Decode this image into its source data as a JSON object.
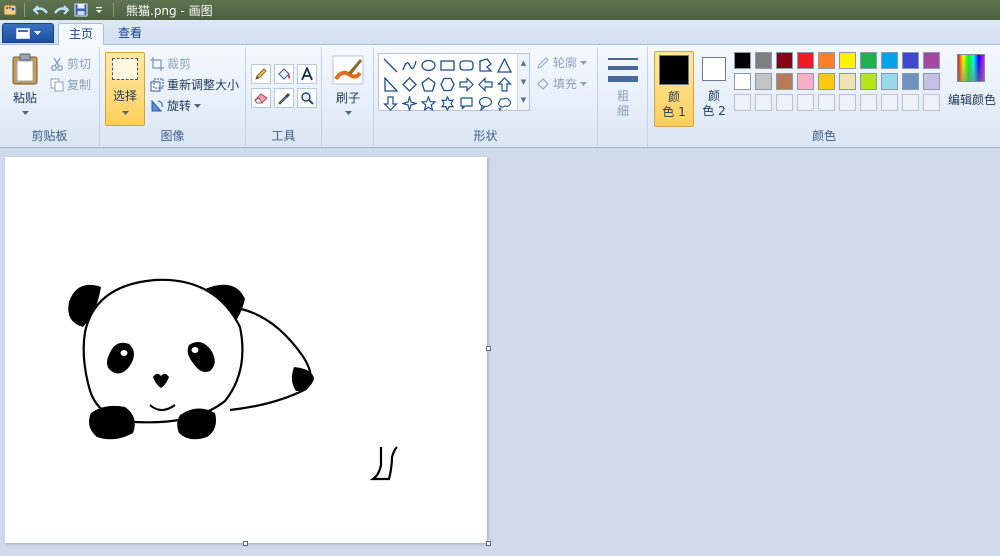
{
  "window": {
    "title": "熊猫.png - 画图"
  },
  "tabs": [
    {
      "label": "主页",
      "active": true
    },
    {
      "label": "查看",
      "active": false
    }
  ],
  "clipboard": {
    "paste": "粘贴",
    "cut": "剪切",
    "copy": "复制",
    "group": "剪贴板"
  },
  "image": {
    "select": "选择",
    "crop": "裁剪",
    "resize": "重新调整大小",
    "rotate": "旋转",
    "group": "图像"
  },
  "tools": {
    "group": "工具"
  },
  "brushes": {
    "label": "刷子"
  },
  "shapes": {
    "outline": "轮廓",
    "fill": "填充",
    "group": "形状"
  },
  "size": {
    "label_line1": "粗",
    "label_line2": "细"
  },
  "colors": {
    "color1_line1": "颜",
    "color1_line2": "色 1",
    "color2_line1": "颜",
    "color2_line2": "色 2",
    "edit": "编辑颜色",
    "group": "颜色",
    "color1": "#000000",
    "color2": "#ffffff",
    "palette": [
      "#000000",
      "#7f7f7f",
      "#880015",
      "#ed1c24",
      "#ff7f27",
      "#fff200",
      "#22b14c",
      "#00a2e8",
      "#3f48cc",
      "#a349a4",
      "#ffffff",
      "#c3c3c3",
      "#b97a57",
      "#ffaec9",
      "#ffc90e",
      "#efe4b0",
      "#b5e61d",
      "#99d9ea",
      "#7092be",
      "#c8bfe7"
    ]
  }
}
